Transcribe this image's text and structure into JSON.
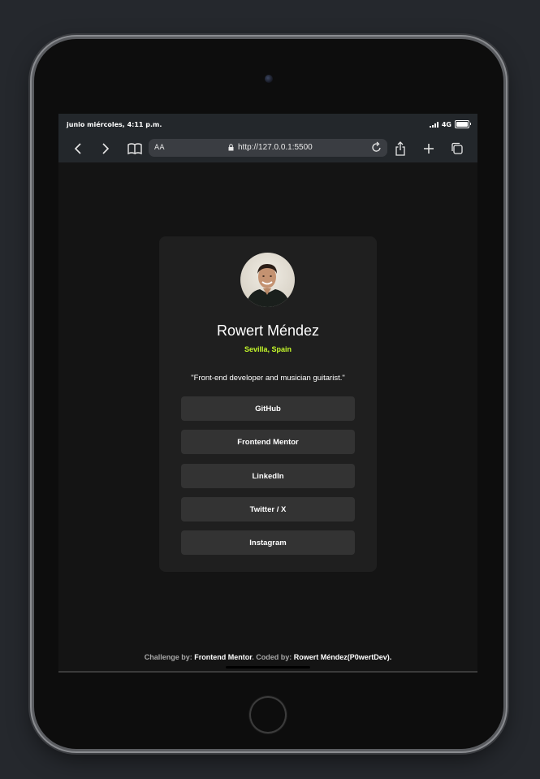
{
  "status": {
    "time": "junio miércoles, 4:11 p.m.",
    "network": "4G"
  },
  "browser": {
    "text_size_label": "AA",
    "url": "http://127.0.0.1:5500"
  },
  "profile": {
    "name": "Rowert Méndez",
    "location": "Sevilla, Spain",
    "bio": "\"Front-end developer and musician guitarist.\"",
    "links": [
      {
        "label": "GitHub"
      },
      {
        "label": "Frontend Mentor"
      },
      {
        "label": "LinkedIn"
      },
      {
        "label": "Twitter / X"
      },
      {
        "label": "Instagram"
      }
    ]
  },
  "footer": {
    "challenge_prefix": "Challenge by: ",
    "challenge_link": "Frontend Mentor",
    "coded_prefix": ". Coded by: ",
    "coded_link": "Rowert Méndez(P0wertDev)",
    "suffix": "."
  },
  "colors": {
    "accent": "#c4f82a",
    "card": "#1f1f1f",
    "button": "#333333",
    "background": "#141414"
  }
}
